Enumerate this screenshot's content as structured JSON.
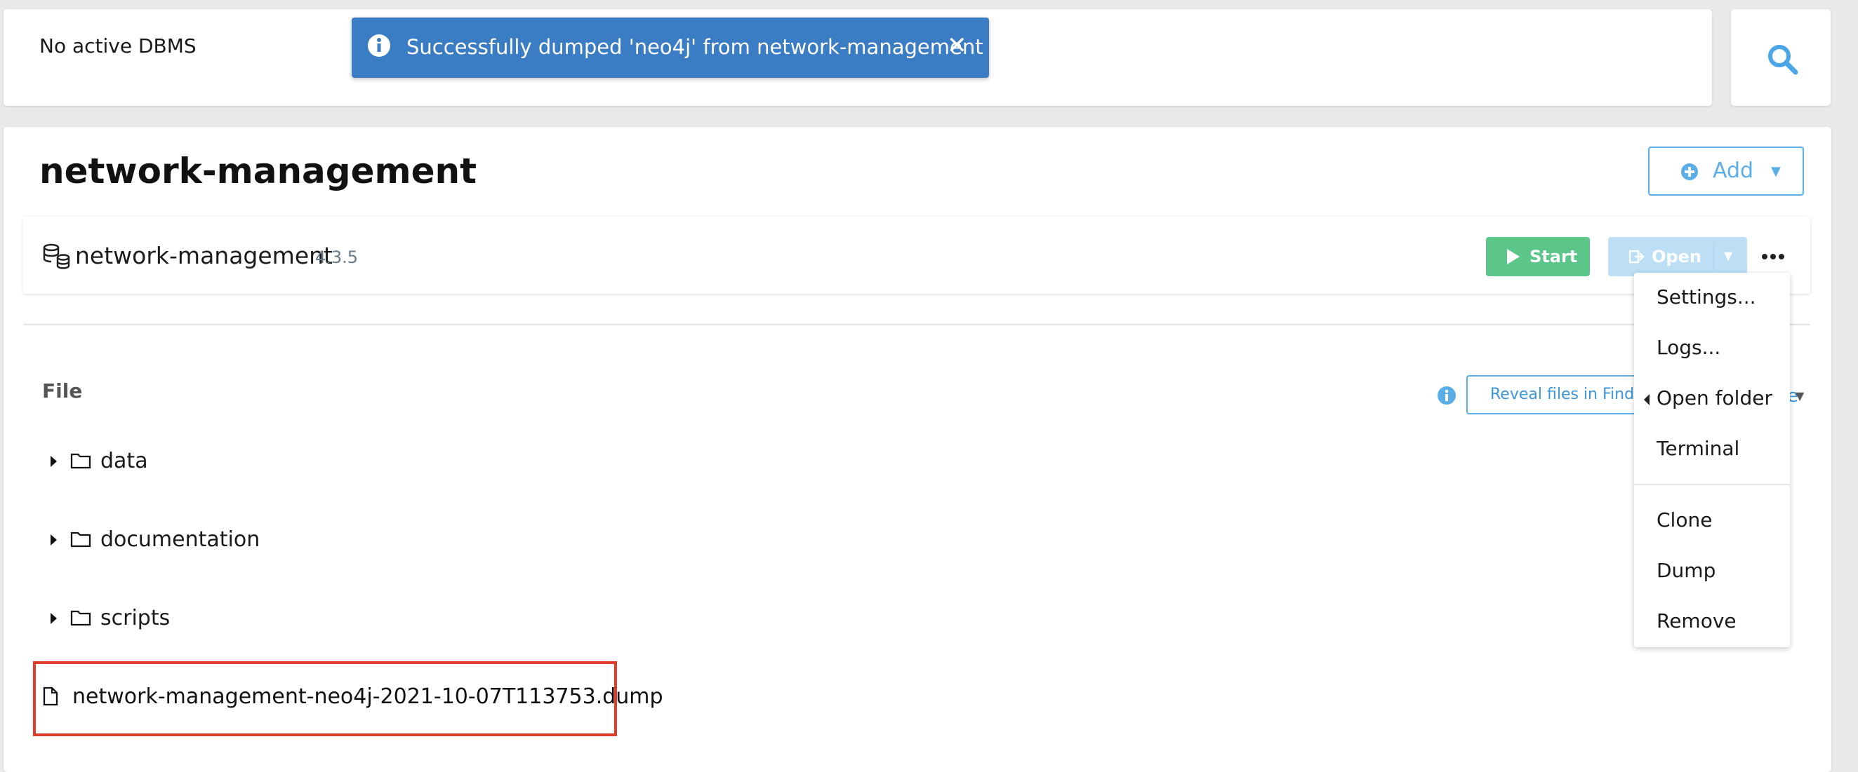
{
  "topbar": {
    "status_text": "No active DBMS"
  },
  "toast": {
    "message": "Successfully dumped 'neo4j' from network-management",
    "close_glyph": "✕"
  },
  "project": {
    "title": "network-management",
    "add_label": "Add",
    "add_caret": "▼"
  },
  "dbms": {
    "name": "network-management",
    "version": "4.3.5",
    "start_label": "Start",
    "open_label": "Open",
    "open_caret": "▼"
  },
  "files": {
    "header": "File",
    "reveal_label": "Reveal files in Finder",
    "hidden_suffix": "e",
    "hidden_caret": "▼",
    "folders": [
      {
        "name": "data"
      },
      {
        "name": "documentation"
      },
      {
        "name": "scripts"
      }
    ],
    "dump_file": "network-management-neo4j-2021-10-07T113753.dump"
  },
  "menu": {
    "items": [
      {
        "label": "Settings..."
      },
      {
        "label": "Logs..."
      },
      {
        "label": "Open folder"
      },
      {
        "label": "Terminal"
      },
      {
        "label": "Clone"
      },
      {
        "label": "Dump"
      },
      {
        "label": "Remove"
      }
    ]
  },
  "colors": {
    "toast_bg": "#3b7dc4",
    "accent": "#5aaee8",
    "start_green": "#5cc58a",
    "open_disabled": "#bcdff6",
    "highlight_red": "#e03c2a"
  },
  "icons": {
    "search": "search-icon",
    "info": "info-icon",
    "close": "close-icon",
    "plus": "plus-circle-icon",
    "database": "database-icon",
    "play": "play-icon",
    "open": "open-external-icon",
    "more": "more-horizontal-icon",
    "folder": "folder-icon",
    "file": "file-icon",
    "caret": "caret-right-icon"
  }
}
